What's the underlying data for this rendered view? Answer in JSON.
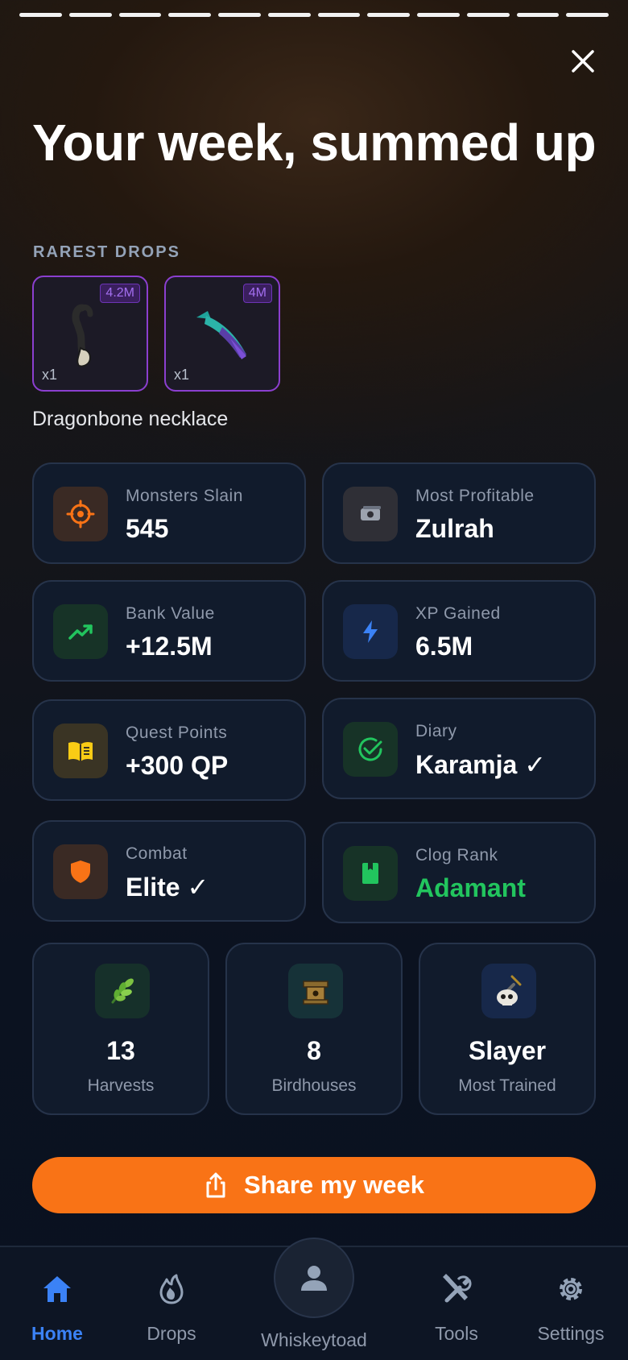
{
  "story": {
    "segments": 12
  },
  "header": {
    "title": "Your week, summed up",
    "close_icon": "close-icon"
  },
  "rarest_drops": {
    "label": "RAREST DROPS",
    "items": [
      {
        "price": "4.2M",
        "qty": "x1",
        "icon": "necklace-icon"
      },
      {
        "price": "4M",
        "qty": "x1",
        "icon": "blade-icon"
      }
    ],
    "selected_name": "Dragonbone necklace"
  },
  "stats": {
    "monsters": {
      "label": "Monsters Slain",
      "value": "545",
      "icon": "target-icon",
      "color": "#f97316"
    },
    "profitable": {
      "label": "Most Profitable",
      "value": "Zulrah",
      "icon": "cash-icon",
      "color": "#9ca3af"
    },
    "bank": {
      "label": "Bank Value",
      "value": "+12.5M",
      "icon": "trend-up-icon",
      "color": "#22c55e"
    },
    "xp": {
      "label": "XP Gained",
      "value": "6.5M",
      "icon": "lightning-icon",
      "color": "#3b82f6"
    },
    "quest": {
      "label": "Quest Points",
      "value": "+300 QP",
      "icon": "book-icon",
      "color": "#facc15"
    },
    "diary": {
      "label": "Diary",
      "value": "Karamja ✓",
      "icon": "check-circle-icon",
      "color": "#22c55e"
    },
    "combat": {
      "label": "Combat",
      "value": "Elite ✓",
      "icon": "shield-icon",
      "color": "#f97316"
    },
    "clog": {
      "label": "Clog Rank",
      "value": "Adamant",
      "icon": "clog-book-icon",
      "color": "#22c55e"
    }
  },
  "small_stats": [
    {
      "value": "13",
      "label": "Harvests",
      "icon": "herb-icon"
    },
    {
      "value": "8",
      "label": "Birdhouses",
      "icon": "birdhouse-icon"
    },
    {
      "value": "Slayer",
      "label": "Most Trained",
      "icon": "slayer-skull-icon"
    }
  ],
  "share": {
    "label": "Share my week",
    "icon": "share-icon"
  },
  "nav": {
    "home": "Home",
    "drops": "Drops",
    "profile": "Whiskeytoad",
    "tools": "Tools",
    "settings": "Settings",
    "active_color": "#3b82f6"
  }
}
